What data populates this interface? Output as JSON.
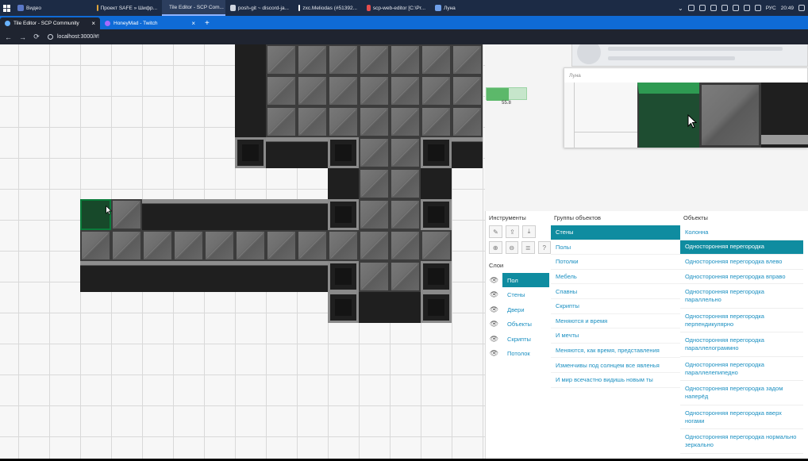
{
  "taskbar": {
    "items": [
      {
        "label": "Видео",
        "color": "#5a78c8"
      },
      {
        "label": "Проект SAFE » Шифр...",
        "color": "#e0a43a"
      },
      {
        "label": "Tile Editor - SCP Com...",
        "color": "#e0a43a",
        "active": true
      },
      {
        "label": "posh-git ~ discord-ja...",
        "color": "#cfd5df"
      },
      {
        "label": "zxc.Meliodas (#51392...",
        "color": "#ffffff"
      },
      {
        "label": "scp-web-editor [C:\\Pr...",
        "color": "#e44d4d"
      },
      {
        "label": "Луна",
        "color": "#6f9fe8"
      }
    ],
    "lang": "РУС",
    "time": "20:49"
  },
  "browser": {
    "tabs": [
      {
        "label": "Tile Editor - SCP Community",
        "active": true
      },
      {
        "label": "HoneyMad - Twitch",
        "active": false
      }
    ],
    "new_tab": "+",
    "close": "×",
    "url": "localhost:3000/#!"
  },
  "zoom": {
    "value": "55.8",
    "fraction": 0.558
  },
  "preview": {
    "title": "Луна"
  },
  "panel": {
    "tools_title": "Инструменты",
    "layers_title": "Слои",
    "groups_title": "Группы объектов",
    "objects_title": "Объекты",
    "tools": [
      [
        "pencil-icon",
        "upload-icon",
        "download-icon"
      ],
      [
        "zoom-in-icon",
        "zoom-out-icon",
        "list-icon",
        "help-icon"
      ]
    ],
    "layers": [
      {
        "label": "Пол",
        "active": true
      },
      {
        "label": "Стены",
        "active": false
      },
      {
        "label": "Двери",
        "active": false
      },
      {
        "label": "Объекты",
        "active": false
      },
      {
        "label": "Скрипты",
        "active": false
      },
      {
        "label": "Потолок",
        "active": false
      }
    ],
    "groups": [
      {
        "label": "Стены",
        "active": true
      },
      {
        "label": "Полы",
        "active": false
      },
      {
        "label": "Потолки",
        "active": false
      },
      {
        "label": "Мебель",
        "active": false
      },
      {
        "label": "Спавны",
        "active": false
      },
      {
        "label": "Скрипты",
        "active": false
      },
      {
        "label": "Меняются и время",
        "active": false
      },
      {
        "label": "И мечты",
        "active": false
      },
      {
        "label": "Меняются, как время, представления",
        "active": false
      },
      {
        "label": "Изменчивы под солнцем все явленья",
        "active": false
      },
      {
        "label": "И мир всечастно видишь новым ты",
        "active": false
      }
    ],
    "objects": [
      {
        "label": "Колонна",
        "active": false
      },
      {
        "label": "Односторонняя перегородка",
        "active": true
      },
      {
        "label": "Односторонняя перегородка влево",
        "active": false
      },
      {
        "label": "Односторонняя перегородка вправо",
        "active": false
      },
      {
        "label": "Односторонняя перегородка параллельно",
        "active": false
      },
      {
        "label": "Односторонняя перегородка перпендикулярно",
        "active": false
      },
      {
        "label": "Односторонняя перегородка параллелограммно",
        "active": false
      },
      {
        "label": "Односторонняя перегородка параллелепипедно",
        "active": false
      },
      {
        "label": "Односторонняя перегородка задом наперёд",
        "active": false
      },
      {
        "label": "Односторонняя перегородка вверх ногами",
        "active": false
      },
      {
        "label": "Односторонняя перегородка нормально зеркально",
        "active": false
      }
    ]
  }
}
